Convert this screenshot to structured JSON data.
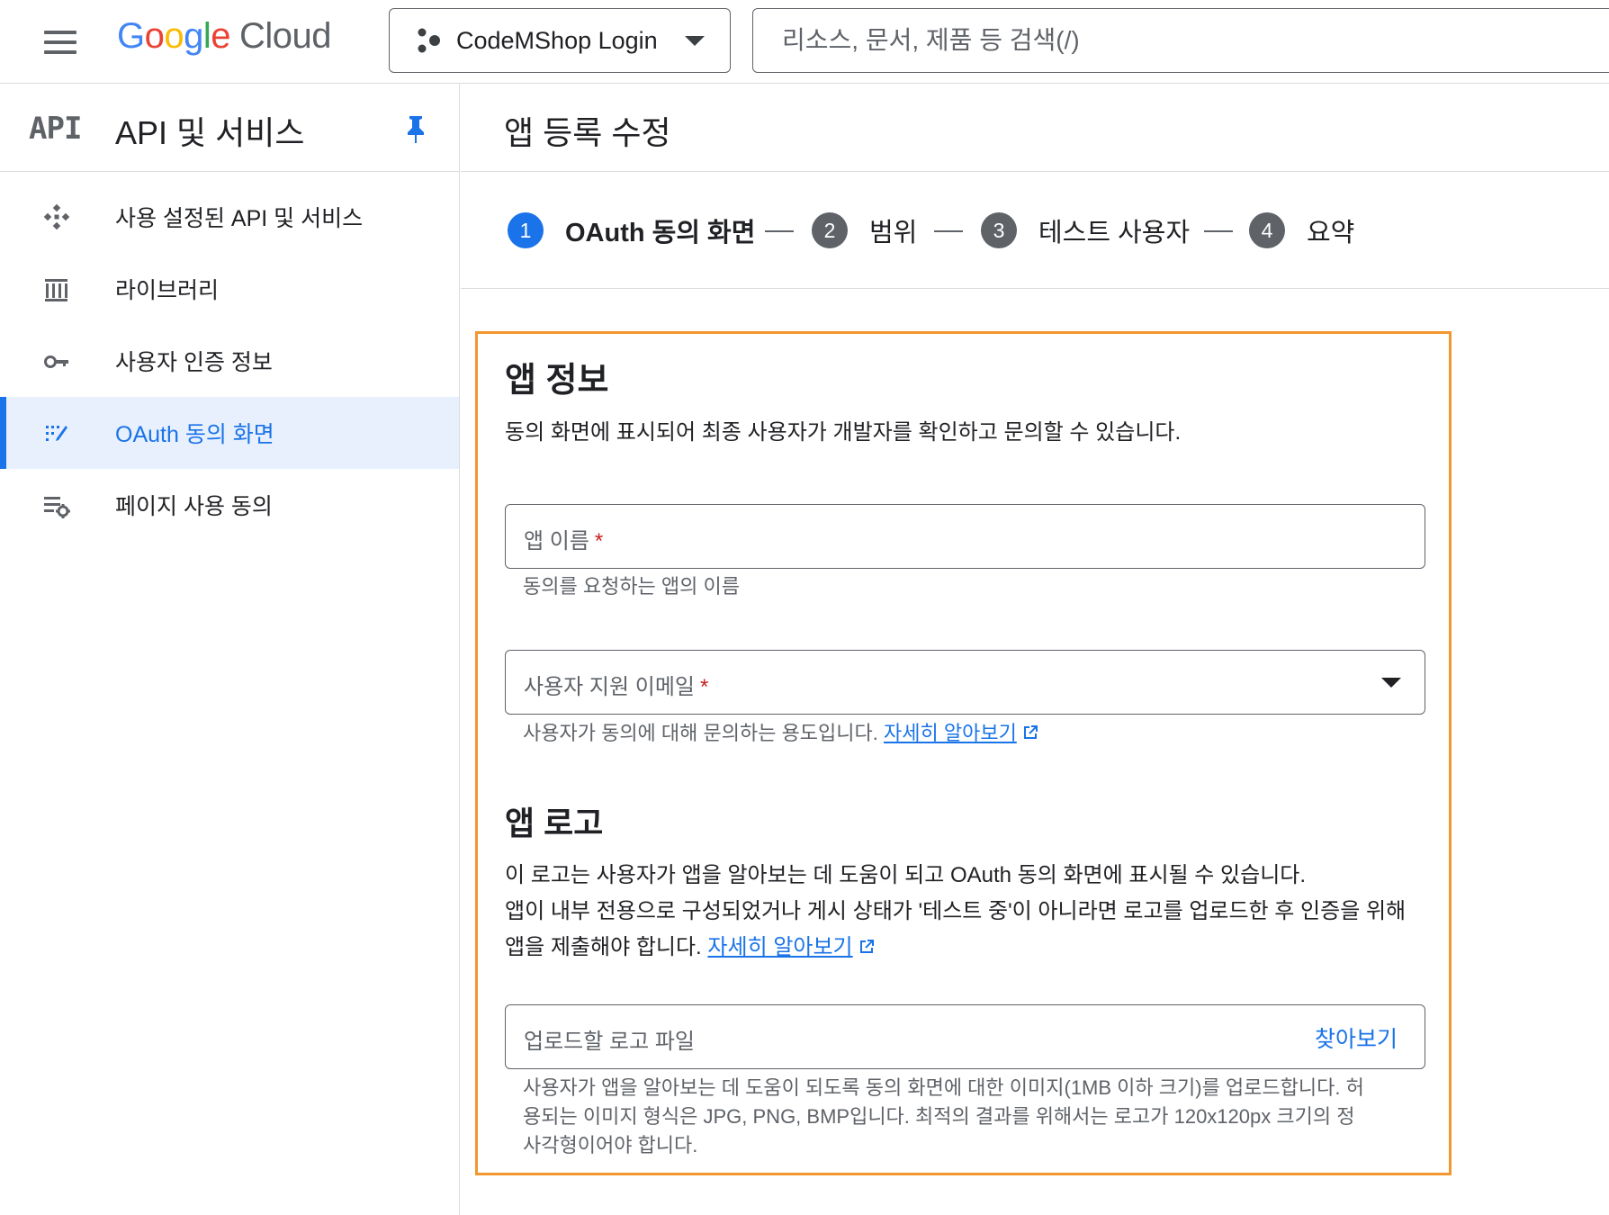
{
  "topbar": {
    "logo_google": [
      "G",
      "o",
      "o",
      "g",
      "l",
      "e"
    ],
    "logo_cloud": "Cloud",
    "project_name": "CodeMShop Login",
    "search_placeholder": "리소스, 문서, 제품 등 검색(/)"
  },
  "sidebar": {
    "badge": "API",
    "title": "API 및 서비스",
    "items": [
      {
        "label": "사용 설정된 API 및 서비스",
        "icon": "diamond-dots-icon"
      },
      {
        "label": "라이브러리",
        "icon": "library-icon"
      },
      {
        "label": "사용자 인증 정보",
        "icon": "key-icon"
      },
      {
        "label": "OAuth 동의 화면",
        "icon": "oauth-consent-icon",
        "active": true
      },
      {
        "label": "페이지 사용 동의",
        "icon": "settings-list-icon"
      }
    ]
  },
  "main": {
    "page_title": "앱 등록 수정",
    "steps": [
      {
        "num": "1",
        "label": "OAuth 동의 화면",
        "active": true
      },
      {
        "num": "2",
        "label": "범위"
      },
      {
        "num": "3",
        "label": "테스트 사용자"
      },
      {
        "num": "4",
        "label": "요약"
      }
    ],
    "app_info": {
      "heading": "앱 정보",
      "description": "동의 화면에 표시되어 최종 사용자가 개발자를 확인하고 문의할 수 있습니다.",
      "app_name_label": "앱 이름",
      "required_mark": "*",
      "app_name_hint": "동의를 요청하는 앱의 이름",
      "email_label": "사용자 지원 이메일",
      "email_hint": "사용자가 동의에 대해 문의하는 용도입니다.",
      "learn_more": "자세히 알아보기"
    },
    "app_logo": {
      "heading": "앱 로고",
      "line1": "이 로고는 사용자가 앱을 알아보는 데 도움이 되고 OAuth 동의 화면에 표시될 수 있습니다.",
      "line2": "앱이 내부 전용으로 구성되었거나 게시 상태가 '테스트 중'이 아니라면 로고를 업로드한 후 인증을 위해",
      "line3": "앱을 제출해야 합니다.",
      "learn_more": "자세히 알아보기",
      "upload_label": "업로드할 로고 파일",
      "browse": "찾아보기",
      "hint1": "사용자가 앱을 알아보는 데 도움이 되도록 동의 화면에 대한 이미지(1MB 이하 크기)를 업로드합니다. 허",
      "hint2": "용되는 이미지 형식은 JPG, PNG, BMP입니다. 최적의 결과를 위해서는 로고가 120x120px 크기의 정",
      "hint3": "사각형이어야 합니다."
    }
  },
  "colors": {
    "accent": "#1a73e8",
    "highlight_border": "#f4962e",
    "required": "#c5221f"
  }
}
